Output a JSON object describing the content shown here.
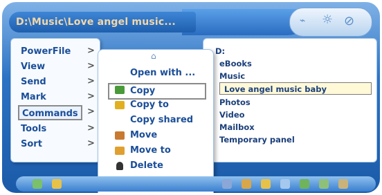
{
  "window": {
    "title": "D:\\Music\\Love angel music..."
  },
  "menu": {
    "items": [
      {
        "label": "PowerFile"
      },
      {
        "label": "View"
      },
      {
        "label": "Send"
      },
      {
        "label": "Mark"
      },
      {
        "label": "Commands"
      },
      {
        "label": "Tools"
      },
      {
        "label": "Sort"
      }
    ],
    "selected": "Commands",
    "arrow": ">"
  },
  "submenu": {
    "up_arrow": "⌂",
    "down_arrow": "▾",
    "items": [
      {
        "label": "Open with ..."
      },
      {
        "label": "Copy"
      },
      {
        "label": "Copy to"
      },
      {
        "label": "Copy shared"
      },
      {
        "label": "Move"
      },
      {
        "label": "Move to"
      },
      {
        "label": "Delete"
      }
    ],
    "selected": "Copy"
  },
  "folders": {
    "drive": "D:",
    "items": [
      {
        "label": "eBooks"
      },
      {
        "label": "Music"
      },
      {
        "label": "Love angel music baby"
      },
      {
        "label": "Photos"
      },
      {
        "label": "Video"
      },
      {
        "label": "Mailbox"
      },
      {
        "label": "Temporary panel"
      }
    ],
    "selected": "Love angel music baby"
  },
  "colors": {
    "accent": "#2d73c4",
    "menu_text": "#1b4e98",
    "title_text": "#f3d7a8"
  }
}
